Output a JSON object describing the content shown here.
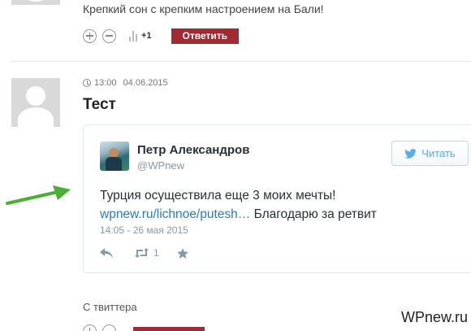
{
  "top_comment": {
    "text": "Крепкий сон с крепким настроением на Бали!",
    "vote_count": "+1",
    "reply_label": "Ответить"
  },
  "comment": {
    "time": "13:00",
    "date": "04.06.2015",
    "title": "Тест"
  },
  "tweet": {
    "author_name": "Петр Александров",
    "author_handle": "@WPnew",
    "follow_label": "Читать",
    "text_before": "Турция осуществила еще 3 моих мечты! ",
    "link": "wpnew.ru/lichnoe/putesh…",
    "text_after": " Благодарю за ретвит",
    "timestamp": "14:05 - 26 мая 2015",
    "retweet_count": "1"
  },
  "section_label": "С твиттера",
  "watermark": "WPnew.ru",
  "colors": {
    "reply_button": "#a12a35",
    "twitter_blue": "#55acee",
    "link": "#2b7bb9",
    "arrow": "#4caf35"
  }
}
